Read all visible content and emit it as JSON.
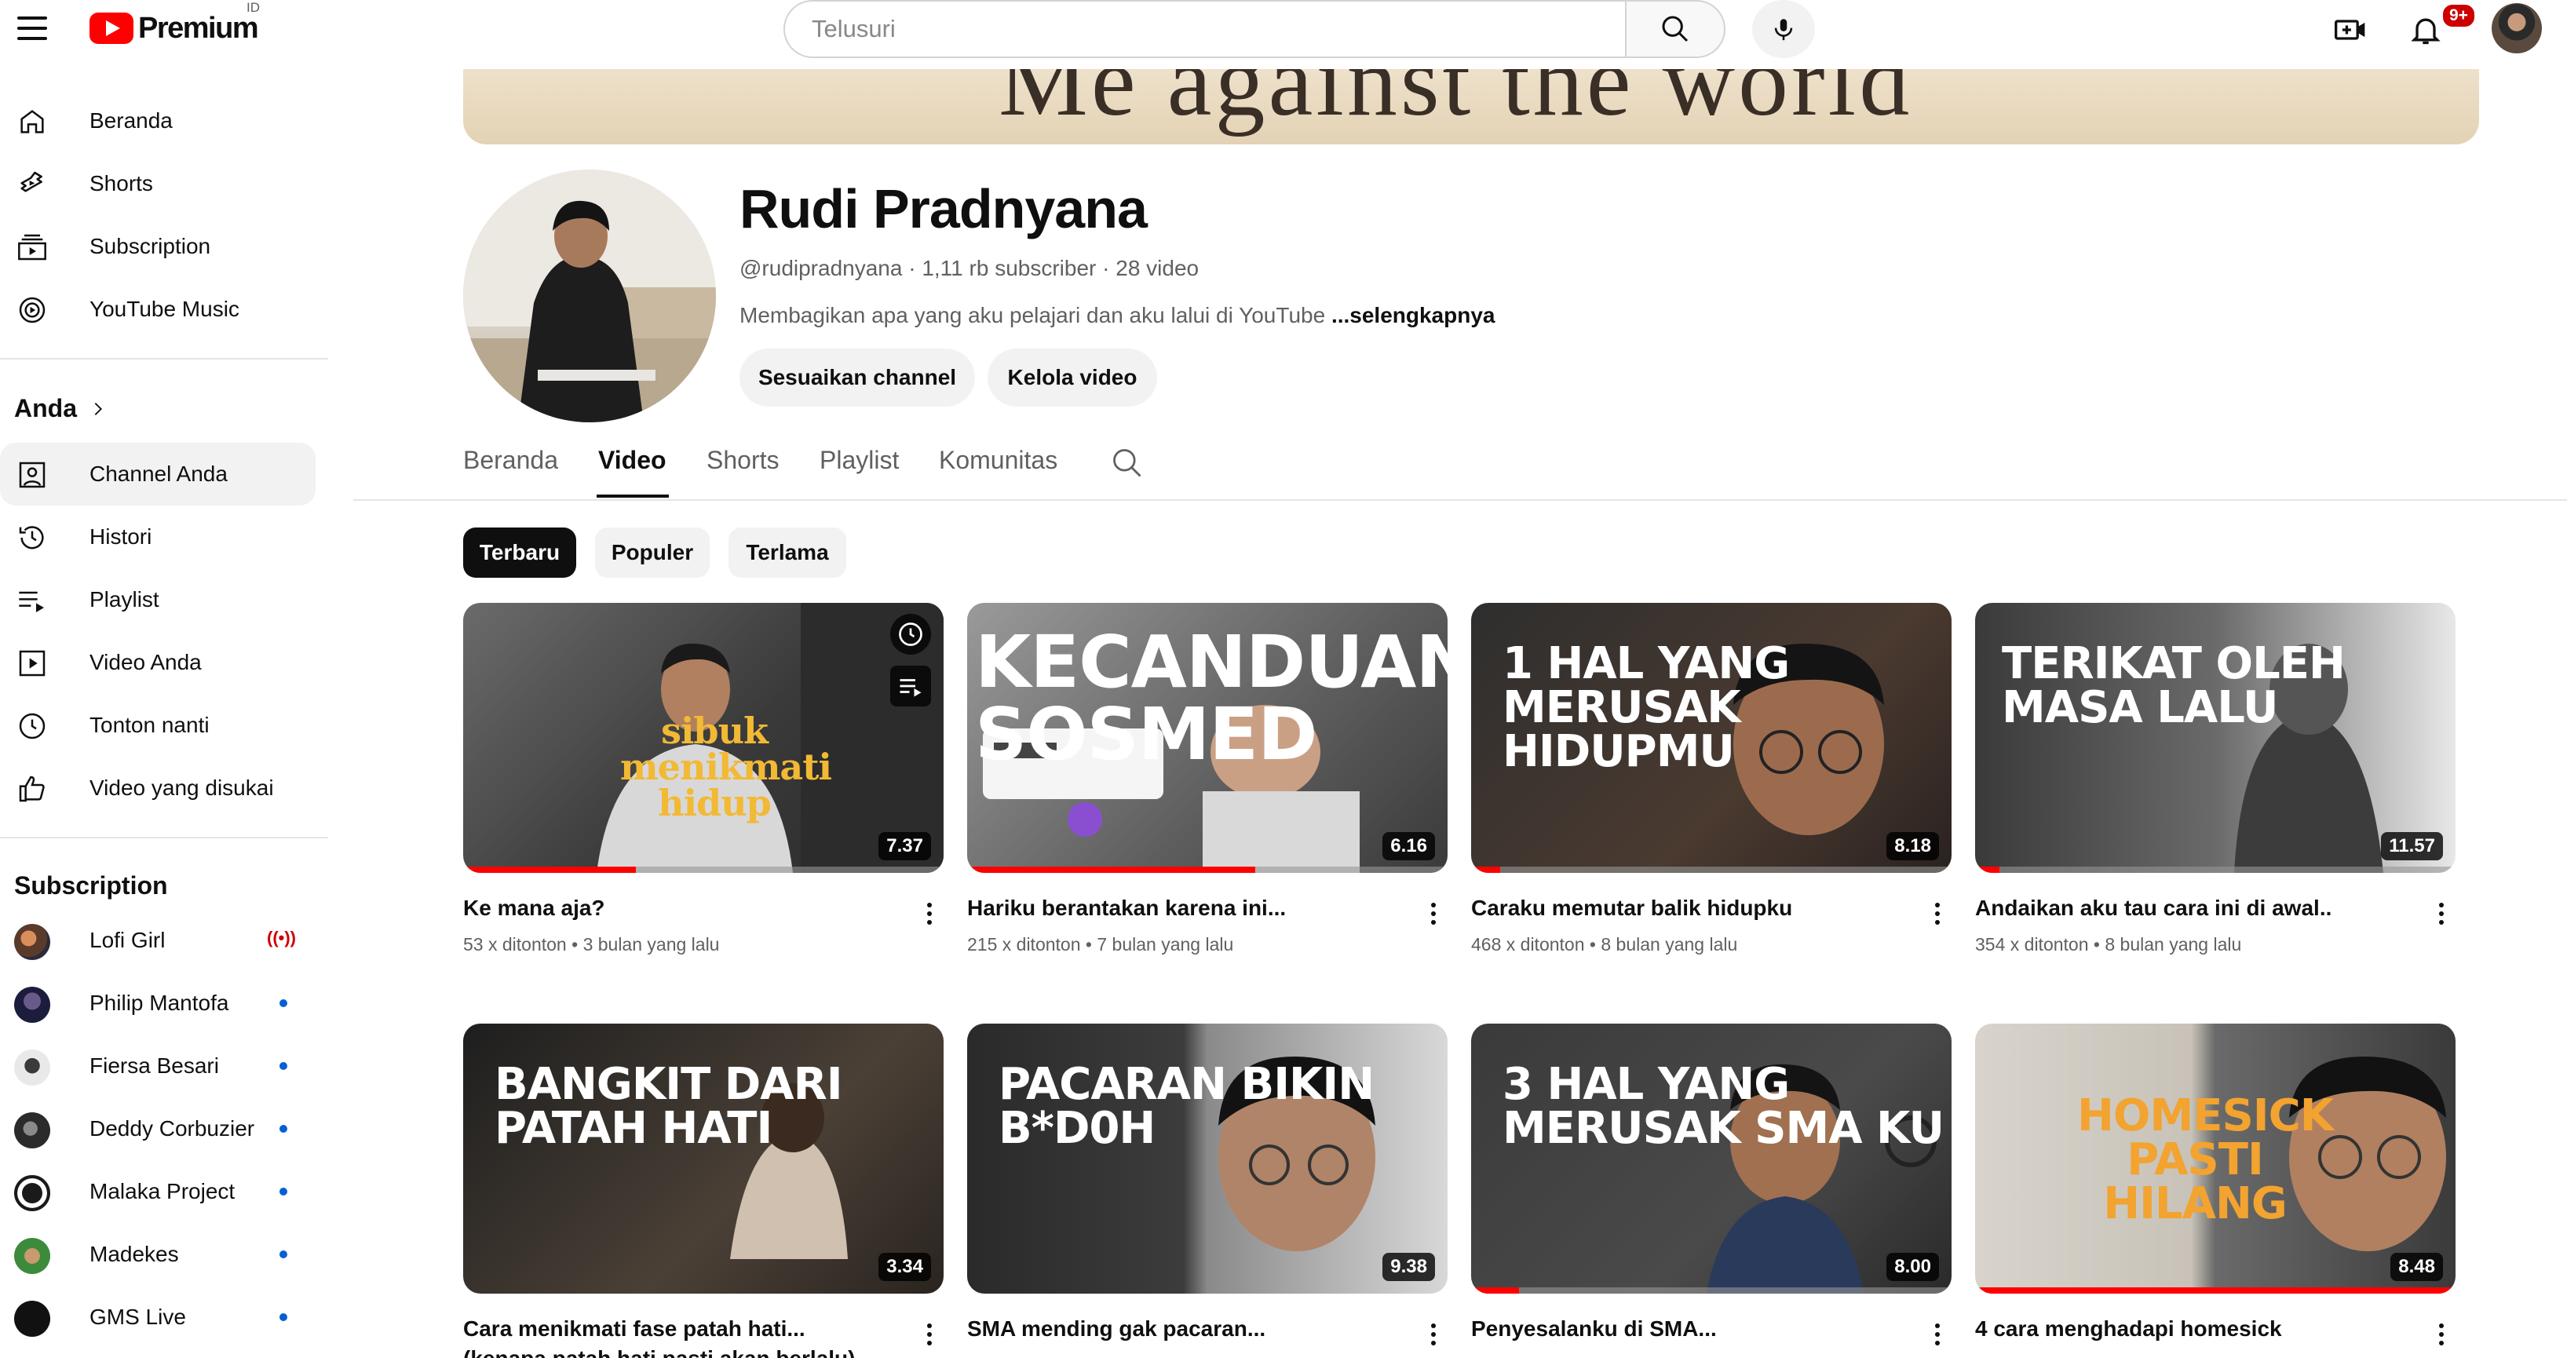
{
  "topbar": {
    "logo_text": "Premium",
    "region": "ID",
    "search_placeholder": "Telusuri",
    "notif_count": "9+"
  },
  "sidebar": {
    "main_items": [
      {
        "label": "Beranda",
        "icon": "home-icon"
      },
      {
        "label": "Shorts",
        "icon": "shorts-icon"
      },
      {
        "label": "Subscription",
        "icon": "subscriptions-icon"
      },
      {
        "label": "YouTube Music",
        "icon": "music-icon"
      }
    ],
    "you_heading": "Anda",
    "you_items": [
      {
        "label": "Channel Anda",
        "icon": "your-channel-icon"
      },
      {
        "label": "Histori",
        "icon": "history-icon"
      },
      {
        "label": "Playlist",
        "icon": "playlist-icon"
      },
      {
        "label": "Video Anda",
        "icon": "your-videos-icon"
      },
      {
        "label": "Tonton nanti",
        "icon": "watch-later-icon"
      },
      {
        "label": "Video yang disukai",
        "icon": "liked-icon"
      }
    ],
    "subs_heading": "Subscription",
    "subscriptions": [
      {
        "name": "Lofi Girl",
        "live": true
      },
      {
        "name": "Philip Mantofa",
        "live": false
      },
      {
        "name": "Fiersa Besari",
        "live": false
      },
      {
        "name": "Deddy Corbuzier",
        "live": false
      },
      {
        "name": "Malaka Project",
        "live": false
      },
      {
        "name": "Madekes",
        "live": false
      },
      {
        "name": "GMS Live",
        "live": false
      }
    ],
    "live_indicator": "((•))"
  },
  "channel": {
    "banner_text": "Me against the world",
    "name": "Rudi Pradnyana",
    "meta": "@rudipradnyana · 1,11 rb subscriber · 28 video",
    "description": "Membagikan apa yang aku pelajari dan aku lalui di YouTube ",
    "more_link": "...selengkapnya",
    "customize_label": "Sesuaikan channel",
    "manage_label": "Kelola video"
  },
  "tabs": [
    "Beranda",
    "Video",
    "Shorts",
    "Playlist",
    "Komunitas"
  ],
  "active_tab": "Video",
  "chips": [
    "Terbaru",
    "Populer",
    "Terlama"
  ],
  "active_chip": "Terbaru",
  "videos": [
    {
      "title": "Ke mana aja?",
      "views": "53 x ditonton",
      "age": "3 bulan yang lalu",
      "duration": "7.37",
      "thumb_text": "sibuk menikmati hidup",
      "progress": 0.36
    },
    {
      "title": "Hariku berantakan karena ini...",
      "views": "215 x ditonton",
      "age": "7 bulan yang lalu",
      "duration": "6.16",
      "thumb_text": "KECANDUAN SOSMED",
      "progress": 0.6
    },
    {
      "title": "Caraku memutar balik hidupku",
      "views": "468 x ditonton",
      "age": "8 bulan yang lalu",
      "duration": "8.18",
      "thumb_text": "1 HAL YANG MERUSAK HIDUPMU",
      "progress": 0.06
    },
    {
      "title": "Andaikan aku tau cara ini di awal..",
      "views": "354 x ditonton",
      "age": "8 bulan yang lalu",
      "duration": "11.57",
      "thumb_text": "TERIKAT OLEH MASA LALU",
      "progress": 0.05
    },
    {
      "title": "Cara menikmati fase patah hati...(kenapa patah hati pasti akan berlalu)",
      "views": "",
      "age": "",
      "duration": "3.34",
      "thumb_text": "BANGKIT DARI PATAH HATI",
      "progress": 0.0
    },
    {
      "title": "SMA mending gak pacaran...",
      "views": "",
      "age": "",
      "duration": "9.38",
      "thumb_text": "PACARAN BIKIN B*D0H",
      "progress": 0.0
    },
    {
      "title": "Penyesalanku di SMA...",
      "views": "",
      "age": "",
      "duration": "8.00",
      "thumb_text": "3 HAL YANG MERUSAK SMA KU",
      "progress": 0.1
    },
    {
      "title": "4 cara menghadapi homesick",
      "views": "",
      "age": "",
      "duration": "8.48",
      "thumb_text": "HOMESICK PASTI HILANG",
      "progress": 1.0
    }
  ]
}
